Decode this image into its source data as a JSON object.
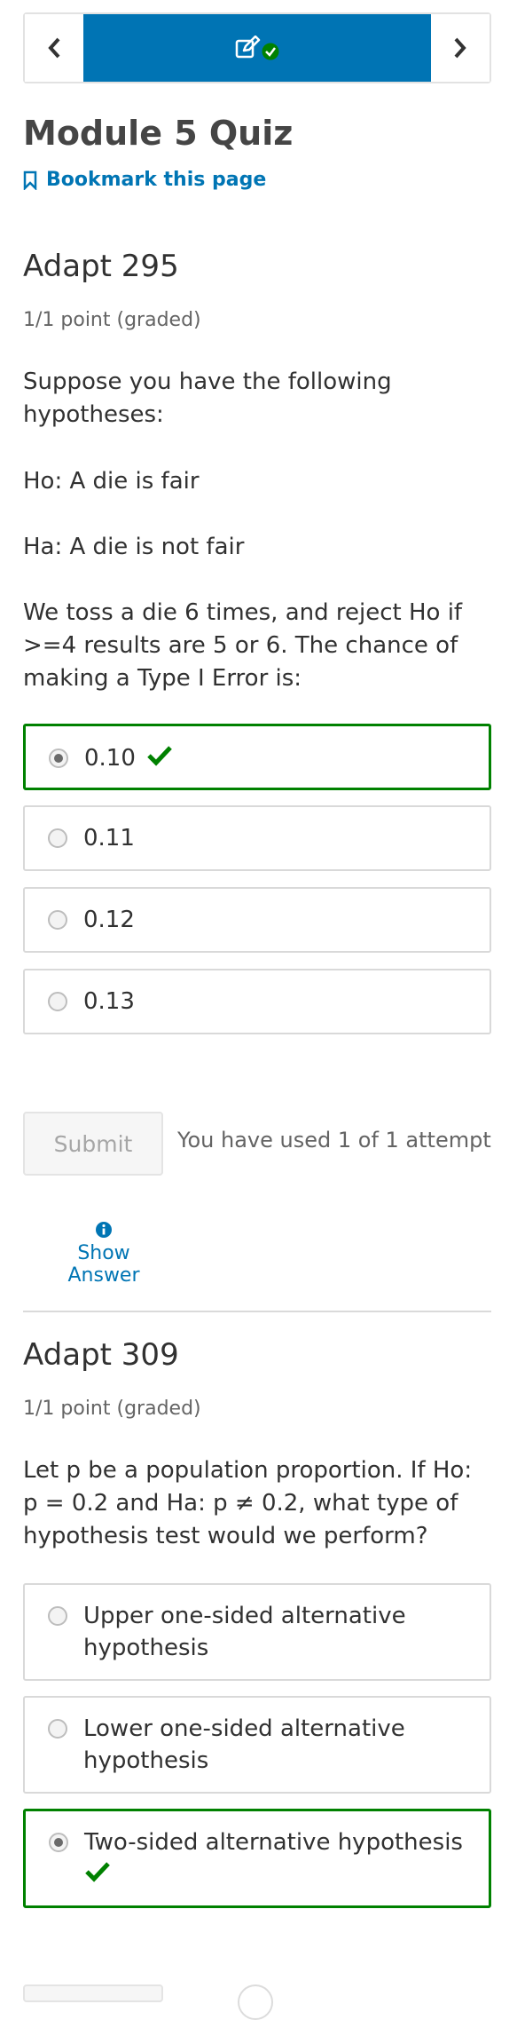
{
  "module_title": "Module 5 Quiz",
  "bookmark_label": "Bookmark this page",
  "problem1": {
    "title": "Adapt 295",
    "grade": "1/1 point (graded)",
    "question_parts": [
      "Suppose you have the following hypotheses:",
      "Ho: A die is fair",
      "Ha: A die is not fair",
      "We toss a die 6 times, and reject Ho if >=4 results are 5 or 6. The chance of making a Type I Error is:"
    ],
    "options": [
      "0.10",
      "0.11",
      "0.12",
      "0.13"
    ],
    "selected_index": 0,
    "correct_index": 0
  },
  "submit_label": "Submit",
  "attempts_text": "You have used 1 of 1 attempt",
  "show_answer_label": "Show Answer",
  "problem2": {
    "title": "Adapt 309",
    "grade": "1/1 point (graded)",
    "question": "Let p be a population proportion. If Ho: p = 0.2 and Ha: p ≠ 0.2, what type of hypothesis test would we perform?",
    "options": [
      "Upper one-sided alternative hypothesis",
      "Lower one-sided alternative hypothesis",
      "Two-sided alternative hypothesis"
    ],
    "selected_index": 2,
    "correct_index": 2
  },
  "colors": {
    "brand_blue": "#0074b4",
    "link_blue": "#0075b4",
    "correct_green": "#008100"
  },
  "icons": {
    "prev": "chevron-left-icon",
    "next": "chevron-right-icon",
    "unit_status": "edit-icon with check-circle-icon",
    "bookmark": "bookmark-icon",
    "info": "info-circle-icon",
    "correct": "checkmark-icon"
  }
}
